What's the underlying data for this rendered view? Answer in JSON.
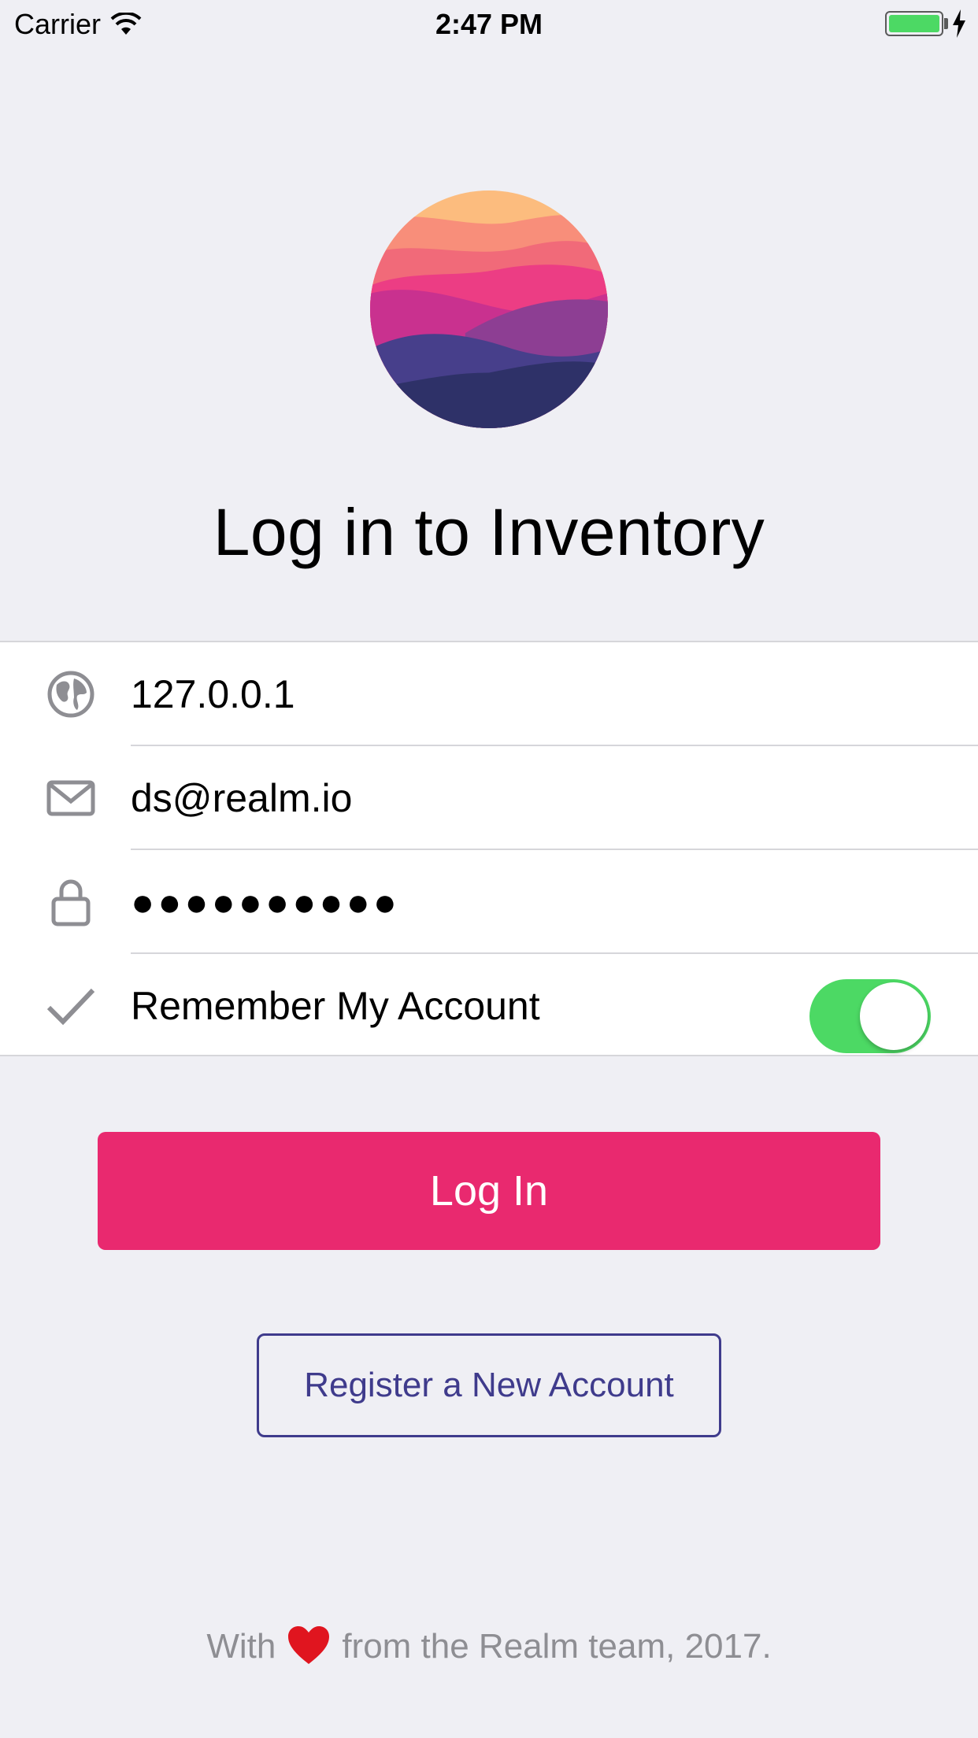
{
  "status_bar": {
    "carrier": "Carrier",
    "time": "2:47 PM",
    "wifi_icon": "wifi-icon",
    "battery_icon": "battery-icon",
    "charging_icon": "bolt-icon",
    "battery_color": "#4cd964"
  },
  "logo_icon": "realm-logo",
  "title": "Log in to Inventory",
  "form": {
    "server": {
      "icon": "globe-icon",
      "value": "127.0.0.1"
    },
    "email": {
      "icon": "envelope-icon",
      "value": "ds@realm.io"
    },
    "password": {
      "icon": "lock-icon",
      "value": "●●●●●●●●●●"
    },
    "remember": {
      "icon": "checkmark-icon",
      "label": "Remember My Account",
      "enabled": true
    }
  },
  "buttons": {
    "login_label": "Log In",
    "register_label": "Register a New Account"
  },
  "footer": {
    "prefix": "With",
    "icon": "heart-icon",
    "suffix": "from the Realm team, 2017."
  },
  "colors": {
    "accent": "#e9296f",
    "secondary": "#3f3b8c",
    "toggle_on": "#4cd964",
    "background": "#efeff4"
  }
}
